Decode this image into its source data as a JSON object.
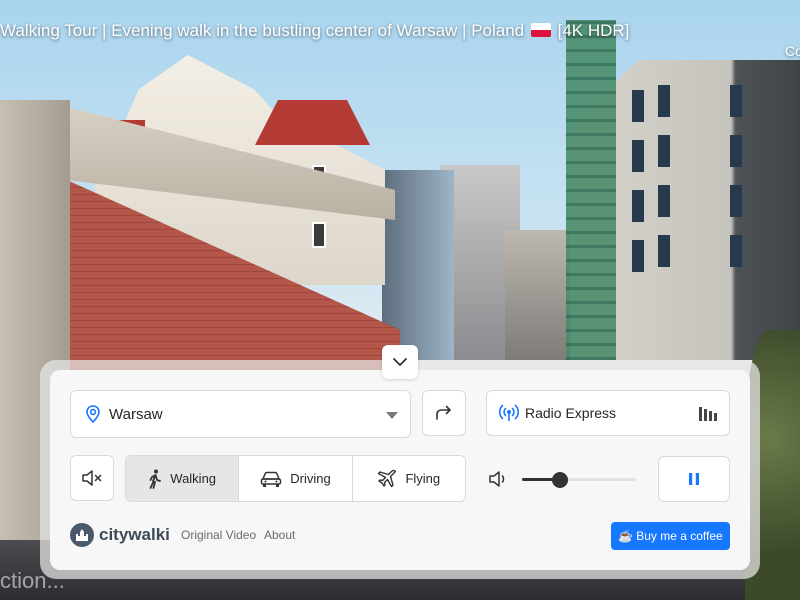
{
  "video": {
    "title_before_flag": "Walking Tour | Evening walk in the bustling center of Warsaw | Poland",
    "title_after_flag": "[4K HDR]",
    "corner_text": "Co",
    "caption_text": "ction..."
  },
  "location": {
    "label": "Warsaw",
    "icon": "map-pin-icon"
  },
  "radio": {
    "label": "Radio Express",
    "icon": "broadcast-icon",
    "bars_icon": "audio-bars-icon"
  },
  "modes": [
    {
      "label": "Walking",
      "icon": "walking-person-icon",
      "active": true
    },
    {
      "label": "Driving",
      "icon": "car-icon",
      "active": false
    },
    {
      "label": "Flying",
      "icon": "airplane-icon",
      "active": false
    }
  ],
  "volume": {
    "level_percent": 33
  },
  "footer": {
    "logo_text": "citywalki",
    "link_original_video": "Original Video",
    "link_about": "About",
    "coffee_label": "Buy me a coffee",
    "coffee_icon": "☕"
  },
  "colors": {
    "accent": "#1677ff",
    "active_tab": "#e6e6e6",
    "pin_icon": "#1677ff"
  }
}
